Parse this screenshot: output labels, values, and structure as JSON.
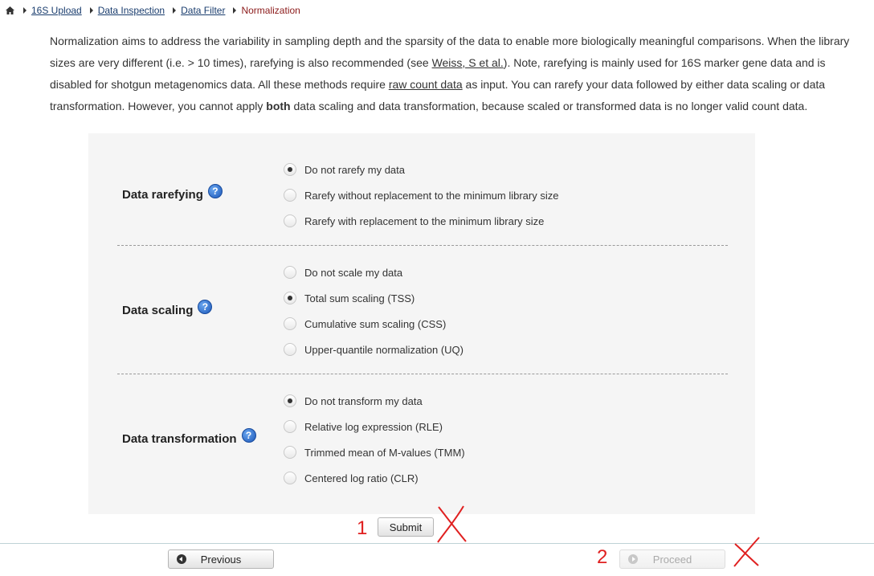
{
  "breadcrumb": {
    "items": [
      "16S Upload",
      "Data Inspection",
      "Data Filter"
    ],
    "current": "Normalization"
  },
  "intro": {
    "p1": "Normalization aims to address the variability in sampling depth and the sparsity of the data to enable more biologically meaningful comparisons. When the library sizes are very different (i.e. > 10 times), rarefying is also recommended (see ",
    "link1": "Weiss, S et al.",
    "p2": "). Note, rarefying is mainly used for 16S marker gene data and is disabled for shotgun metagenomics data. All these methods require ",
    "link2": "raw count data",
    "p3": " as input. You can rarefy your data followed by either data scaling or data transformation. However, you cannot apply ",
    "bold": "both",
    "p4": " data scaling and data transformation, because scaled or transformed data is no longer valid count data."
  },
  "sections": {
    "rarefying": {
      "label": "Data rarefying",
      "options": [
        "Do not rarefy my data",
        "Rarefy without replacement to the minimum library size",
        "Rarefy with replacement to the minimum library size"
      ],
      "selected": 0
    },
    "scaling": {
      "label": "Data scaling",
      "options": [
        "Do not scale my data",
        "Total sum scaling (TSS)",
        "Cumulative sum scaling (CSS)",
        "Upper-quantile normalization (UQ)"
      ],
      "selected": 1
    },
    "transformation": {
      "label": "Data transformation",
      "options": [
        "Do not transform my data",
        "Relative log expression (RLE)",
        "Trimmed mean of M-values (TMM)",
        "Centered log ratio (CLR)"
      ],
      "selected": 0
    }
  },
  "buttons": {
    "submit": "Submit",
    "previous": "Previous",
    "proceed": "Proceed"
  },
  "annotations": {
    "num1": "1",
    "num2": "2",
    "color": "#e02020"
  },
  "icons": {
    "home": "home-icon",
    "help": "help-icon",
    "prev": "circle-arrow-left-icon",
    "next": "circle-arrow-right-icon"
  }
}
